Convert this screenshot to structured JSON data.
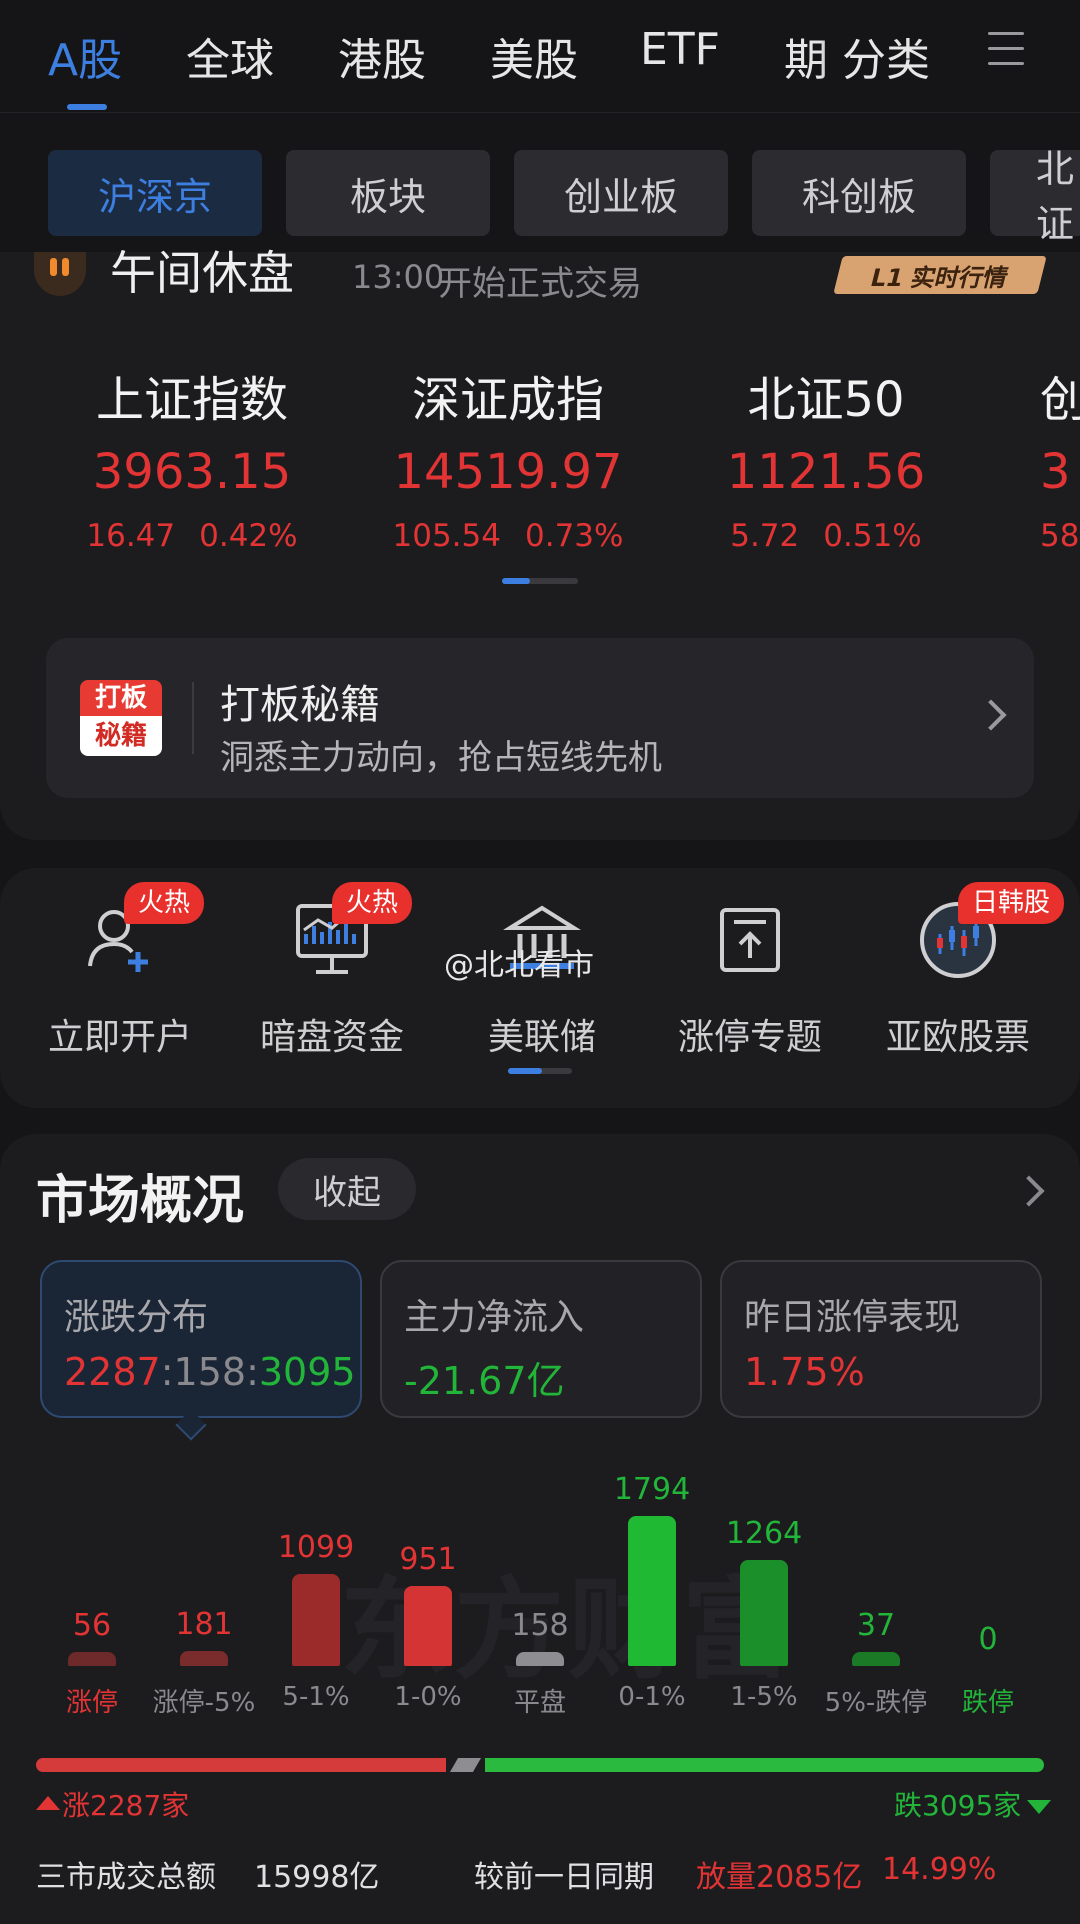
{
  "top_tabs": [
    "A股",
    "全球",
    "港股",
    "美股",
    "ETF",
    "期",
    "分类"
  ],
  "top_tab_active": 0,
  "sub_tabs": [
    "沪深京",
    "板块",
    "创业板",
    "科创板",
    "北证"
  ],
  "sub_tab_active": 0,
  "status": {
    "title": "午间休盘",
    "time": "13:00",
    "desc": "开始正式交易",
    "badge": "L1 实时行情"
  },
  "indices": [
    {
      "name": "上证指数",
      "value": "3963.15",
      "change": "16.47",
      "pct": "0.42%"
    },
    {
      "name": "深证成指",
      "value": "14519.97",
      "change": "105.54",
      "pct": "0.73%"
    },
    {
      "name": "北证50",
      "value": "1121.56",
      "change": "5.72",
      "pct": "0.51%"
    },
    {
      "name": "创",
      "value": "3",
      "change": "58.",
      "pct": ""
    }
  ],
  "promo": {
    "logo_top": "打板",
    "logo_bottom": "秘籍",
    "title": "打板秘籍",
    "subtitle": "洞悉主力动向，抢占短线先机"
  },
  "tools": [
    {
      "label": "立即开户",
      "icon": "user-add-icon",
      "badge": "火热"
    },
    {
      "label": "暗盘资金",
      "icon": "monitor-chart-icon",
      "badge": "火热"
    },
    {
      "label": "美联储",
      "icon": "bank-icon",
      "badge": ""
    },
    {
      "label": "涨停专题",
      "icon": "upload-box-icon",
      "badge": ""
    },
    {
      "label": "亚欧股票",
      "icon": "globe-candle-icon",
      "badge": "日韩股"
    }
  ],
  "watermark": "@北北看市",
  "market": {
    "title": "市场概况",
    "collapse": "收起",
    "stats": [
      {
        "label": "涨跌分布",
        "up": "2287",
        "flat": "158",
        "down": "3095"
      },
      {
        "label": "主力净流入",
        "value": "-21.67亿"
      },
      {
        "label": "昨日涨停表现",
        "value": "1.75%"
      }
    ],
    "rise_label": "涨2287家",
    "fall_label": "跌3095家",
    "turnover_label": "三市成交总额",
    "turnover_value": "15998亿",
    "compare_label": "较前一日同期",
    "compare_value": "放量2085亿",
    "compare_pct": "14.99%",
    "logo_watermark": "东方财富"
  },
  "colors": {
    "up": "#e23434",
    "down": "#22b53a",
    "flat": "#8d8d92",
    "accent": "#3d7fe0"
  },
  "chart_data": {
    "type": "bar",
    "categories": [
      "涨停",
      "涨停-5%",
      "5-1%",
      "1-0%",
      "平盘",
      "0-1%",
      "1-5%",
      "5%-跌停",
      "跌停"
    ],
    "values": [
      56,
      181,
      1099,
      951,
      158,
      1794,
      1264,
      37,
      0
    ],
    "bar_colors": [
      "#6e2a2a",
      "#7a2c2c",
      "#9b2a2a",
      "#d43434",
      "#8d8d92",
      "#20b934",
      "#1a8f2a",
      "#1a7a26",
      "#1a7a26"
    ],
    "label_colors": [
      "#e23434",
      "#e23434",
      "#e23434",
      "#e23434",
      "#8a8a8e",
      "#22b53a",
      "#22b53a",
      "#22b53a",
      "#22b53a"
    ],
    "cat_colors": [
      "#e23434",
      "#8a8a8e",
      "#8a8a8e",
      "#8a8a8e",
      "#8a8a8e",
      "#8a8a8e",
      "#8a8a8e",
      "#8a8a8e",
      "#22b53a"
    ]
  }
}
